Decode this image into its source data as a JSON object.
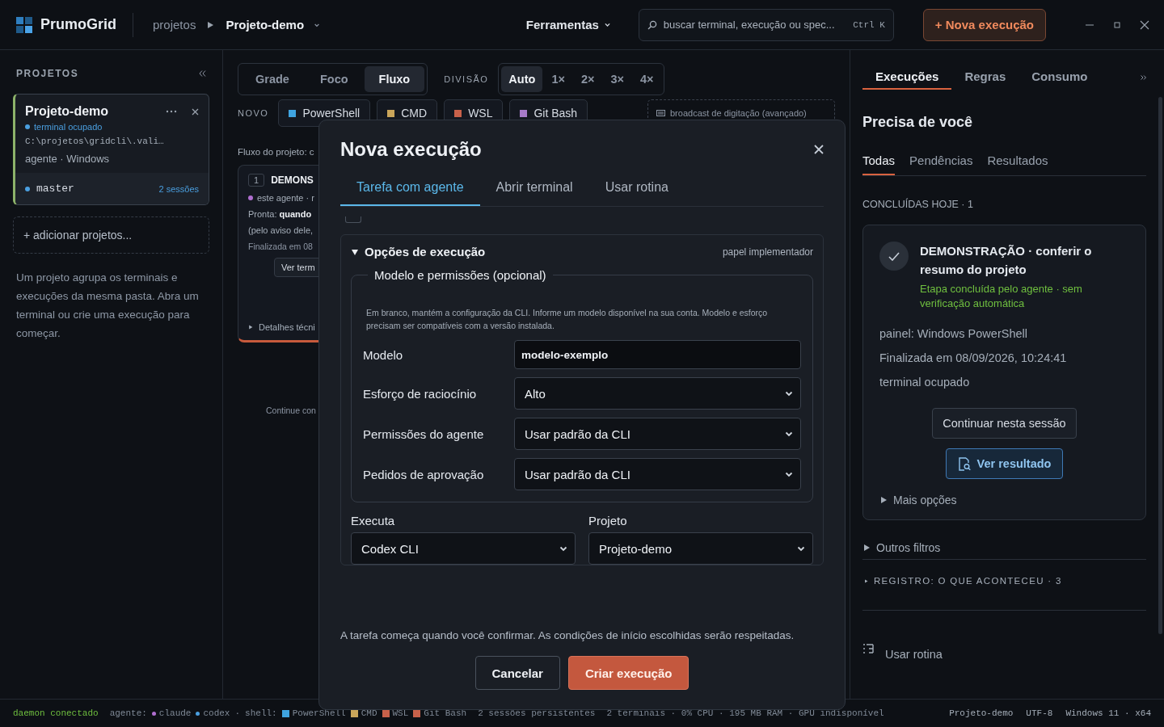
{
  "app": {
    "name": "PrumoGrid"
  },
  "breadcrumb": {
    "root": "projetos",
    "current": "Projeto-demo"
  },
  "tools_menu": {
    "label": "Ferramentas"
  },
  "search": {
    "placeholder": "buscar terminal, execução ou spec...",
    "shortcut": "Ctrl K"
  },
  "new_button": "+ Nova execução",
  "sidebar": {
    "title": "PROJETOS",
    "project": {
      "name": "Projeto-demo",
      "status": "terminal ocupado",
      "path": "C:\\projetos\\gridcli\\.vali…",
      "meta": "agente · Windows",
      "branch": "master",
      "sessions": "2 sessões",
      "selected": true
    },
    "add": "+ adicionar projetos...",
    "help": "Um projeto agrupa os terminais e execuções da mesma pasta. Abra um terminal ou crie uma execução para começar."
  },
  "view_tabs": [
    {
      "label": "Grade",
      "selected": false
    },
    {
      "label": "Foco",
      "selected": false
    },
    {
      "label": "Fluxo",
      "selected": true
    }
  ],
  "division": {
    "label": "DIVISÃO",
    "options": [
      {
        "label": "Auto",
        "selected": true
      },
      {
        "label": "1×",
        "selected": false
      },
      {
        "label": "2×",
        "selected": false
      },
      {
        "label": "3×",
        "selected": false
      },
      {
        "label": "4×",
        "selected": false
      }
    ]
  },
  "new_terminal": {
    "label": "NOVO",
    "shells": [
      {
        "label": "PowerShell",
        "color": "#3fa4e0"
      },
      {
        "label": "CMD",
        "color": "#c9a55a"
      },
      {
        "label": "WSL",
        "color": "#c8614a"
      },
      {
        "label": "Git Bash",
        "color": "#a77bc9"
      }
    ]
  },
  "broadcast": "broadcast de digitação (avançado)",
  "flow": {
    "caption": "Fluxo do projeto: c",
    "card": {
      "step": "1",
      "title": "DEMONS",
      "agent": "este agente · r",
      "ready": "Pronta:  **quando**",
      "note": "(pelo aviso dele,",
      "finished": "Finalizada em 08",
      "button": "Ver term",
      "details": "Detalhes técni",
      "details_expanded": false
    },
    "continue": "Continue con"
  },
  "modal": {
    "title": "Nova execução",
    "tabs": [
      {
        "label": "Tarefa com agente",
        "selected": true
      },
      {
        "label": "Abrir terminal",
        "selected": false
      },
      {
        "label": "Usar rotina",
        "selected": false
      }
    ],
    "options": {
      "title": "Opções de execução",
      "expanded": true,
      "role": "papel implementador",
      "legend": "Modelo e permissões (opcional)",
      "help": "Em branco, mantém a configuração da CLI. Informe um modelo disponível na sua conta. Modelo e esforço precisam ser compatíveis com a versão instalada.",
      "fields": [
        {
          "label": "Modelo",
          "kind": "input",
          "value": "modelo-exemplo"
        },
        {
          "label": "Esforço de raciocínio",
          "kind": "select",
          "value": "Alto"
        },
        {
          "label": "Permissões do agente",
          "kind": "select",
          "value": "Usar padrão da CLI"
        },
        {
          "label": "Pedidos de aprovação",
          "kind": "select",
          "value": "Usar padrão da CLI"
        }
      ],
      "run": [
        {
          "label": "Executa",
          "value": "Codex CLI"
        },
        {
          "label": "Projeto",
          "value": "Projeto-demo"
        }
      ]
    },
    "footer_note": "A tarefa começa quando você confirmar. As condições de início escolhidas serão respeitadas.",
    "cancel": "Cancelar",
    "confirm": "Criar execução"
  },
  "right_panel": {
    "tabs": [
      {
        "label": "Execuções",
        "selected": true
      },
      {
        "label": "Regras",
        "selected": false
      },
      {
        "label": "Consumo",
        "selected": false
      }
    ],
    "heading": "Precisa de você",
    "filters": [
      {
        "label": "Todas",
        "selected": true
      },
      {
        "label": "Pendências",
        "selected": false
      },
      {
        "label": "Resultados",
        "selected": false
      }
    ],
    "group_label": "CONCLUÍDAS HOJE · 1",
    "run_card": {
      "title": "DEMONSTRAÇÃO · conferir o resumo do projeto",
      "status": "Etapa concluída pelo agente · sem verificação automática",
      "lines": [
        "painel: Windows PowerShell",
        "Finalizada em 08/09/2026, 10:24:41",
        "terminal ocupado"
      ],
      "continue": "Continuar nesta sessão",
      "result": "Ver resultado",
      "more": "Mais opções",
      "more_expanded": false
    },
    "other_filters": {
      "label": "Outros filtros",
      "expanded": false
    },
    "log": {
      "label": "REGISTRO: O QUE ACONTECEU · 3",
      "expanded": false
    },
    "routine": "Usar rotina"
  },
  "status_bar": {
    "daemon": "daemon conectado",
    "agents_label": "agente:",
    "agents": [
      {
        "name": "claude",
        "color": "#b06fd0"
      },
      {
        "name": "codex",
        "color": "#4a9fe0"
      }
    ],
    "sep": "·",
    "shell_label": "shell:",
    "shells": [
      {
        "name": "PowerShell",
        "color": "#3fa4e0"
      },
      {
        "name": "CMD",
        "color": "#c9a55a"
      },
      {
        "name": "WSL",
        "color": "#c8614a"
      },
      {
        "name": "Git Bash",
        "color": "#c8614a"
      }
    ],
    "info": [
      "2 sessões persistentes",
      "2 terminais · 0% CPU · 195 MB RAM · GPU indisponível"
    ],
    "right": [
      "Projeto-demo",
      "UTF-8",
      "Windows 11 · x64"
    ]
  }
}
